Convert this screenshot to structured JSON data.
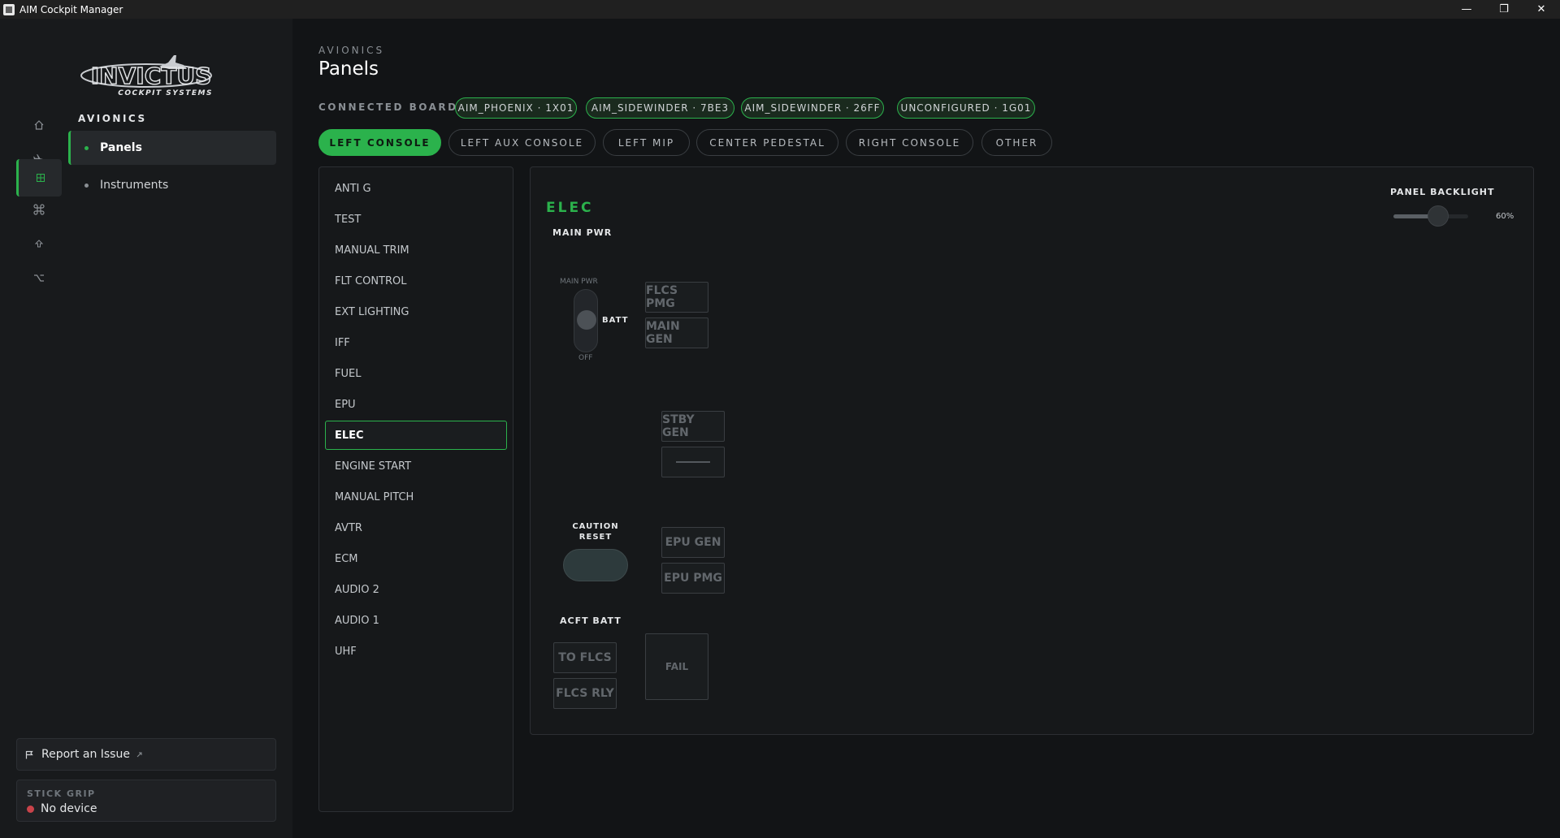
{
  "window": {
    "title": "AIM Cockpit Manager",
    "minimize": "—",
    "restore": "❐",
    "close": "✕"
  },
  "rail": {
    "icons": [
      "home-icon",
      "plane-icon",
      "grid-icon",
      "command-icon",
      "upload-icon",
      "option-icon"
    ],
    "active_index": 2
  },
  "logo": {
    "brand": "INVICTUS",
    "subtitle": "COCKPIT SYSTEMS"
  },
  "sidebar": {
    "heading": "AVIONICS",
    "items": [
      {
        "label": "Panels",
        "active": true
      },
      {
        "label": "Instruments",
        "active": false
      }
    ],
    "report_label": "Report an Issue",
    "stick_grip": {
      "heading": "STICK GRIP",
      "status": "No device",
      "status_color": "#c9434a"
    }
  },
  "header": {
    "eyebrow": "AVIONICS",
    "title": "Panels"
  },
  "boards": {
    "label": "CONNECTED BOARDS",
    "chips": [
      "AIM_PHOENIX · 1X01",
      "AIM_SIDEWINDER · 7BE3",
      "AIM_SIDEWINDER · 26FF",
      "UNCONFIGURED · 1G01"
    ]
  },
  "tabs": [
    {
      "label": "LEFT CONSOLE",
      "active": true
    },
    {
      "label": "LEFT AUX CONSOLE",
      "active": false
    },
    {
      "label": "LEFT MIP",
      "active": false
    },
    {
      "label": "CENTER PEDESTAL",
      "active": false
    },
    {
      "label": "RIGHT CONSOLE",
      "active": false
    },
    {
      "label": "OTHER",
      "active": false
    }
  ],
  "panel_list": [
    "ANTI G",
    "TEST",
    "MANUAL TRIM",
    "FLT CONTROL",
    "EXT LIGHTING",
    "IFF",
    "FUEL",
    "EPU",
    "ELEC",
    "ENGINE START",
    "MANUAL PITCH",
    "AVTR",
    "ECM",
    "AUDIO 2",
    "AUDIO 1",
    "UHF"
  ],
  "panel_list_active": "ELEC",
  "elec": {
    "title": "ELEC",
    "backlight": {
      "label": "PANEL BACKLIGHT",
      "value_text": "60%",
      "value": 0.6
    },
    "main_pwr": {
      "label": "MAIN PWR",
      "switch_top": "MAIN PWR",
      "switch_position": "BATT",
      "switch_bottom": "OFF"
    },
    "indicators": {
      "flcs_pmg": "FLCS PMG",
      "main_gen": "MAIN GEN",
      "stby_gen": "STBY GEN",
      "epu_gen": "EPU GEN",
      "epu_pmg": "EPU PMG",
      "to_flcs": "TO FLCS",
      "flcs_rly": "FLCS RLY",
      "fail": "FAIL"
    },
    "caution_reset": "CAUTION RESET",
    "acft_batt": "ACFT BATT"
  },
  "colors": {
    "accent": "#2bb24c",
    "background": "#121416",
    "alert": "#c9434a"
  }
}
